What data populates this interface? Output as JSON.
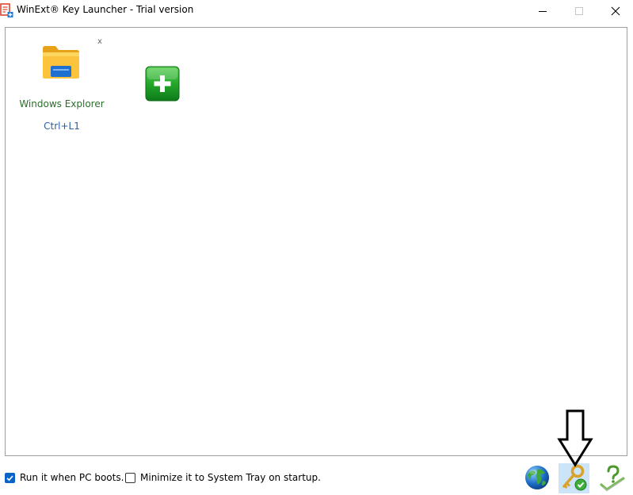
{
  "window": {
    "title": "WinExt® Key Launcher - Trial version",
    "app_icon": "launcher-app-icon"
  },
  "launcher_items": [
    {
      "name": "Windows Explorer",
      "hotkey": "Ctrl+L1",
      "icon": "folder-icon",
      "remove_label": "x"
    }
  ],
  "add_button": {
    "icon": "plus-icon"
  },
  "options": {
    "run_on_boot": {
      "label": "Run it when PC boots.",
      "checked": true
    },
    "minimize_to_tray": {
      "label": "Minimize it to System Tray on startup.",
      "checked": false
    }
  },
  "toolbar": {
    "icons": [
      "globe-icon",
      "key-check-icon",
      "help-check-icon"
    ]
  },
  "colors": {
    "item_name": "#2b6e2b",
    "hotkey": "#2a5fa0",
    "checkbox_checked": "#0a64c8",
    "key_highlight": "#cce4f7"
  }
}
